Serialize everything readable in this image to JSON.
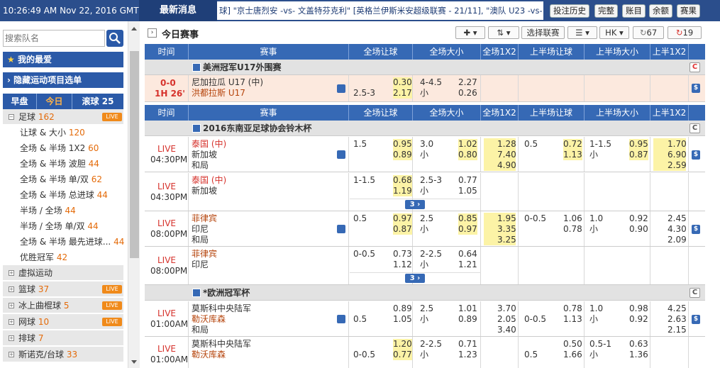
{
  "topbar": {
    "clock": "10:26:49 AM Nov 22, 2016 GMT +8",
    "news_label": "最新消息",
    "ticker": "球] \"京士唐烈安 -vs- 文盖特芬克利\" [英格兰伊斯米安超级联赛 - 21/11], \"澳队 U23 -vs- 史",
    "buttons": [
      "投注历史",
      "完整",
      "账目",
      "余额",
      "赛果"
    ]
  },
  "sidebar": {
    "search_placeholder": "搜索队名",
    "favorites": "我的最爱",
    "hidden_sports": "隐藏运动项目选单",
    "tabs": {
      "early": "早盘",
      "today": "今日",
      "live": "滚球",
      "live_count": "25"
    },
    "football": {
      "label": "足球",
      "count": "162",
      "live": "LIVE"
    },
    "sub_items": [
      {
        "label": "让球 & 大小",
        "count": "120"
      },
      {
        "label": "全场 & 半场 1X2",
        "count": "60"
      },
      {
        "label": "全场 & 半场 波胆",
        "count": "44"
      },
      {
        "label": "全场 & 半场 单/双",
        "count": "62"
      },
      {
        "label": "全场 & 半场 总进球",
        "count": "44"
      },
      {
        "label": "半场 / 全场",
        "count": "44"
      },
      {
        "label": "半场 / 全场 单/双",
        "count": "44"
      },
      {
        "label": "全场 & 半场 最先进球...",
        "count": "44"
      },
      {
        "label": "优胜冠军",
        "count": "42"
      }
    ],
    "sports": [
      {
        "label": "虚拟运动",
        "count": "",
        "live": ""
      },
      {
        "label": "篮球",
        "count": "37",
        "live": "LIVE"
      },
      {
        "label": "冰上曲棍球",
        "count": "5",
        "live": "LIVE"
      },
      {
        "label": "网球",
        "count": "10",
        "live": "LIVE"
      },
      {
        "label": "排球",
        "count": "7",
        "live": ""
      },
      {
        "label": "斯诺克/台球",
        "count": "33",
        "live": ""
      }
    ]
  },
  "main": {
    "title": "今日赛事",
    "toolbar": {
      "select_league": "选择联赛",
      "odds_type": "HK",
      "refresh1": "67",
      "refresh2": "19"
    },
    "headers": [
      "时间",
      "赛事",
      "全场让球",
      "全场大小",
      "全场1X2",
      "上半场让球",
      "上半场大小",
      "上半1X2"
    ],
    "leagues": [
      {
        "name": "美洲冠军U17外围赛",
        "matches": [
          {
            "time1": "0-0",
            "time2": "1H 26'",
            "home": "尼加拉瓜 U17 (中)",
            "away": "洪都拉斯 U17",
            "hdp_line2": "2.5-3",
            "hdp_o1": "0.30",
            "hdp_o2": "2.17",
            "ou_line1": "4-4.5",
            "ou_line2": "小",
            "ou_o1": "2.27",
            "ou_o2": "0.26"
          }
        ]
      },
      {
        "name": "2016东南亚足球协会铃木杯",
        "matches": [
          {
            "time1": "LIVE",
            "time2": "04:30PM",
            "home": "泰国 (中)",
            "away": "新加坡",
            "draw": "和局",
            "hdp_line1": "1.5",
            "hdp_o1": "0.95",
            "hdp_o2": "0.89",
            "ou_line1": "3.0",
            "ou_line2": "小",
            "ou_o1": "1.02",
            "ou_o2": "0.80",
            "x1": "1.28",
            "x2": "7.40",
            "x3": "4.90",
            "h_hdp_line1": "0.5",
            "h_hdp_o1": "0.72",
            "h_hdp_o2": "1.13",
            "h_ou_line1": "1-1.5",
            "h_ou_line2": "小",
            "h_ou_o1": "0.95",
            "h_ou_o2": "0.87",
            "hx1": "1.70",
            "hx2": "6.90",
            "hx3": "2.59"
          },
          {
            "time1": "LIVE",
            "time2": "04:30PM",
            "home": "泰国 (中)",
            "away": "新加坡",
            "hdp_line1": "1-1.5",
            "hdp_o1": "0.68",
            "hdp_o2": "1.19",
            "ou_line1": "2.5-3",
            "ou_line2": "小",
            "ou_o1": "0.77",
            "ou_o2": "1.05",
            "more": "3"
          },
          {
            "time1": "LIVE",
            "time2": "08:00PM",
            "home": "菲律宾",
            "away": "印尼",
            "draw": "和局",
            "hdp_line1": "0.5",
            "hdp_o1": "0.97",
            "hdp_o2": "0.87",
            "ou_line1": "2.5",
            "ou_line2": "小",
            "ou_o1": "0.85",
            "ou_o2": "0.97",
            "x1": "1.95",
            "x2": "3.35",
            "x3": "3.25",
            "h_hdp_line1": "0-0.5",
            "h_hdp_o1": "1.06",
            "h_hdp_o2": "0.78",
            "h_ou_line1": "1.0",
            "h_ou_line2": "小",
            "h_ou_o1": "0.92",
            "h_ou_o2": "0.90",
            "hx1": "2.45",
            "hx2": "4.30",
            "hx3": "2.09"
          },
          {
            "time1": "LIVE",
            "time2": "08:00PM",
            "home": "菲律宾",
            "away": "印尼",
            "hdp_line1": "0-0.5",
            "hdp_o1": "0.73",
            "hdp_o2": "1.12",
            "ou_line1": "2-2.5",
            "ou_line2": "小",
            "ou_o1": "0.64",
            "ou_o2": "1.21",
            "more": "3"
          }
        ]
      },
      {
        "name": "*欧洲冠军杯",
        "matches": [
          {
            "time1": "LIVE",
            "time2": "01:00AM",
            "home": "莫斯科中央陆军",
            "away": "勒沃库森",
            "draw": "和局",
            "hdp_line2": "0.5",
            "hdp_o1": "0.89",
            "hdp_o2": "1.05",
            "ou_line1": "2.5",
            "ou_line2": "小",
            "ou_o1": "1.01",
            "ou_o2": "0.89",
            "x1": "3.70",
            "x2": "2.05",
            "x3": "3.40",
            "h_hdp_line2": "0-0.5",
            "h_hdp_o1": "0.78",
            "h_hdp_o2": "1.13",
            "h_ou_line1": "1.0",
            "h_ou_line2": "小",
            "h_ou_o1": "0.98",
            "h_ou_o2": "0.92",
            "hx1": "4.25",
            "hx2": "2.63",
            "hx3": "2.15"
          },
          {
            "time1": "LIVE",
            "time2": "01:00AM",
            "home": "莫斯科中央陆军",
            "away": "勒沃库森",
            "hdp_line2": "0-0.5",
            "hdp_o1": "1.20",
            "hdp_o2": "0.77",
            "ou_line1": "2-2.5",
            "ou_line2": "小",
            "ou_o1": "0.71",
            "ou_o2": "1.23",
            "h_hdp_line2": "0.5",
            "h_hdp_o1": "0.50",
            "h_hdp_o2": "1.66",
            "h_ou_line1": "0.5-1",
            "h_ou_line2": "小",
            "h_ou_o1": "0.63",
            "h_ou_o2": "1.36"
          }
        ]
      }
    ]
  }
}
